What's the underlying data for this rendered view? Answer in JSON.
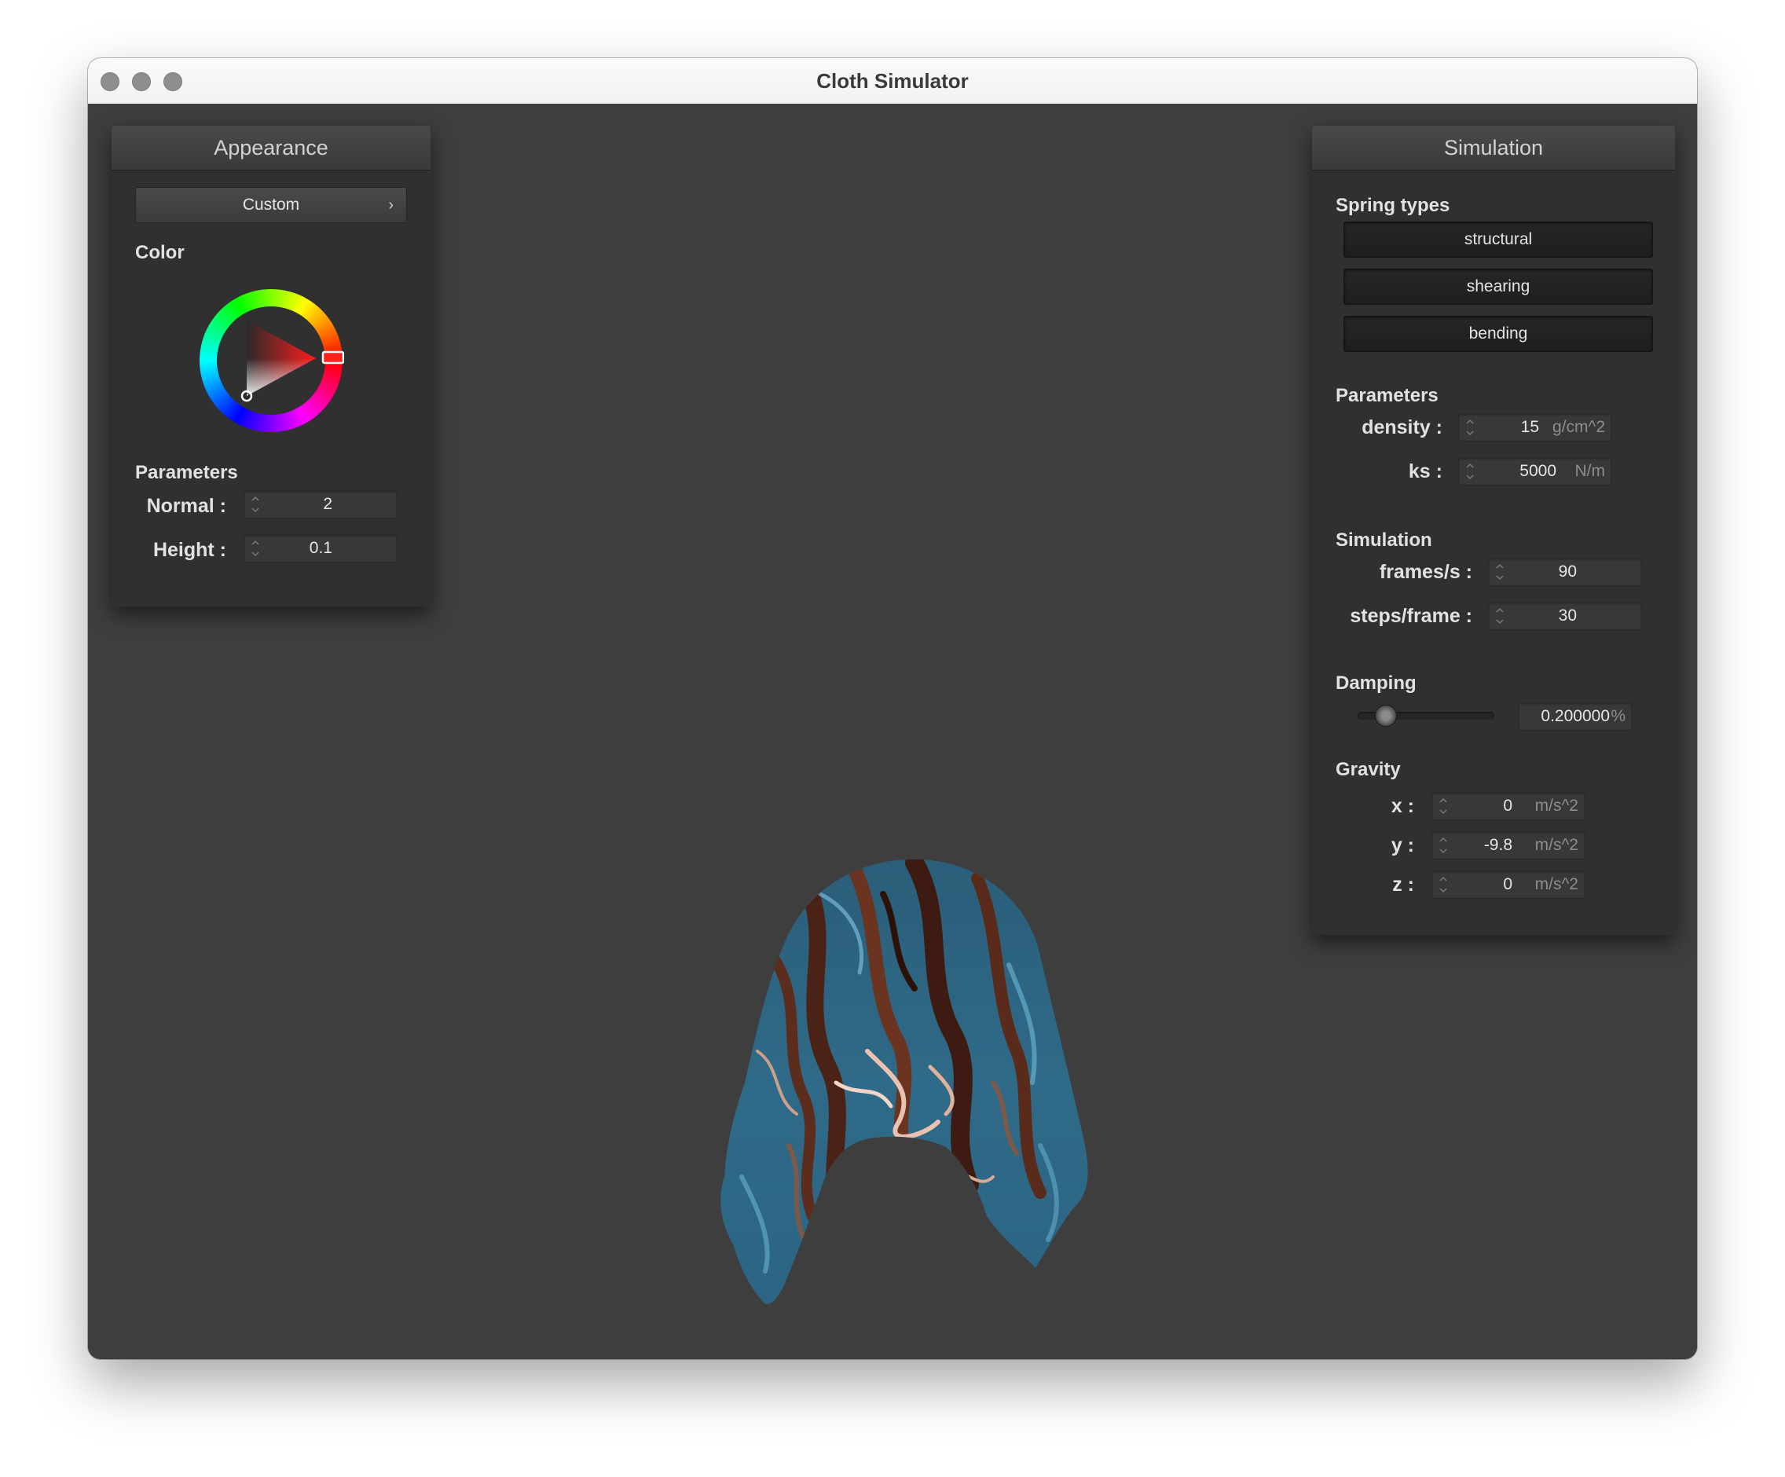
{
  "window": {
    "title": "Cloth Simulator"
  },
  "appearance": {
    "header": "Appearance",
    "shader_selected": "Custom",
    "color_label": "Color",
    "color_value": "#ff2020",
    "parameters_label": "Parameters",
    "normal": {
      "label": "Normal :",
      "value": "2"
    },
    "height": {
      "label": "Height :",
      "value": "0.1"
    }
  },
  "simulation_panel": {
    "header": "Simulation",
    "spring_types_label": "Spring types",
    "spring_types": [
      "structural",
      "shearing",
      "bending"
    ],
    "parameters_label": "Parameters",
    "density": {
      "label": "density :",
      "value": "15",
      "unit": "g/cm^2"
    },
    "ks": {
      "label": "ks :",
      "value": "5000",
      "unit": "N/m"
    },
    "simulation_label": "Simulation",
    "frames": {
      "label": "frames/s :",
      "value": "90"
    },
    "steps": {
      "label": "steps/frame :",
      "value": "30"
    },
    "damping_label": "Damping",
    "damping": {
      "value": "0.200000",
      "unit": "%",
      "slider_fraction": 0.2
    },
    "gravity_label": "Gravity",
    "gravity": {
      "x": {
        "label": "x :",
        "value": "0",
        "unit": "m/s^2"
      },
      "y": {
        "label": "y :",
        "value": "-9.8",
        "unit": "m/s^2"
      },
      "z": {
        "label": "z :",
        "value": "0",
        "unit": "m/s^2"
      }
    }
  }
}
